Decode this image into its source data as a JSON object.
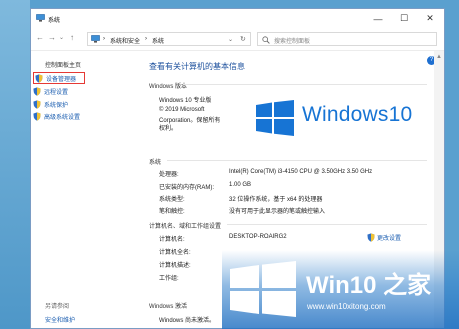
{
  "window": {
    "title": "系统",
    "minimize_glyph": "—",
    "maximize_glyph": "☐",
    "close_glyph": "✕"
  },
  "nav": {
    "back": "←",
    "forward": "→",
    "up": "↑",
    "dropdown": "⌄",
    "refresh": "↻"
  },
  "breadcrumb": {
    "sep1": "›",
    "item1": "系统和安全",
    "sep2": "›",
    "item2": "系统"
  },
  "search": {
    "placeholder": "搜索控制面板"
  },
  "sidebar": {
    "home": "控制面板主页",
    "items": [
      {
        "label": "设备管理器",
        "icon": "shield-icon",
        "highlighted": true
      },
      {
        "label": "远程设置",
        "icon": "shield-icon"
      },
      {
        "label": "系统保护",
        "icon": "shield-icon"
      },
      {
        "label": "高级系统设置",
        "icon": "shield-icon"
      }
    ],
    "see_also": "另请参阅",
    "security": "安全和维护"
  },
  "main": {
    "title": "查看有关计算机的基本信息",
    "edition_section": "Windows 版本",
    "edition": "Windows 10 专业版",
    "copyright_line1": "© 2019 Microsoft",
    "copyright_line2": "Corporation。保留所有",
    "copyright_line3": "权利。",
    "windows_logo_text": "Windows10",
    "system_section": "系统",
    "system_rows": [
      {
        "label": "处理器:",
        "value": "Intel(R) Core(TM) i3-4150 CPU @ 3.50GHz   3.50 GHz"
      },
      {
        "label": "已安装的内存(RAM):",
        "value": "1.00 GB"
      },
      {
        "label": "系统类型:",
        "value": "32 位操作系统，基于 x64 的处理器"
      },
      {
        "label": "笔和触控:",
        "value": "没有可用于此显示器的笔或触控输入"
      }
    ],
    "computer_section": "计算机名、域和工作组设置",
    "computer_rows": [
      {
        "label": "计算机名:",
        "value": "DESKTOP-ROAIRG2"
      },
      {
        "label": "计算机全名:",
        "value": ""
      },
      {
        "label": "计算机描述:",
        "value": ""
      },
      {
        "label": "工作组:",
        "value": ""
      }
    ],
    "change_settings": "更改设置",
    "activation_section": "Windows 激活",
    "activation_text": "Windows 尚未激活。"
  },
  "watermark": {
    "title": "Win10 之家",
    "url": "www.win10xitong.com"
  },
  "colors": {
    "accent": "#1774d4",
    "link": "#1a5db0",
    "highlight_border": "#e53935"
  }
}
